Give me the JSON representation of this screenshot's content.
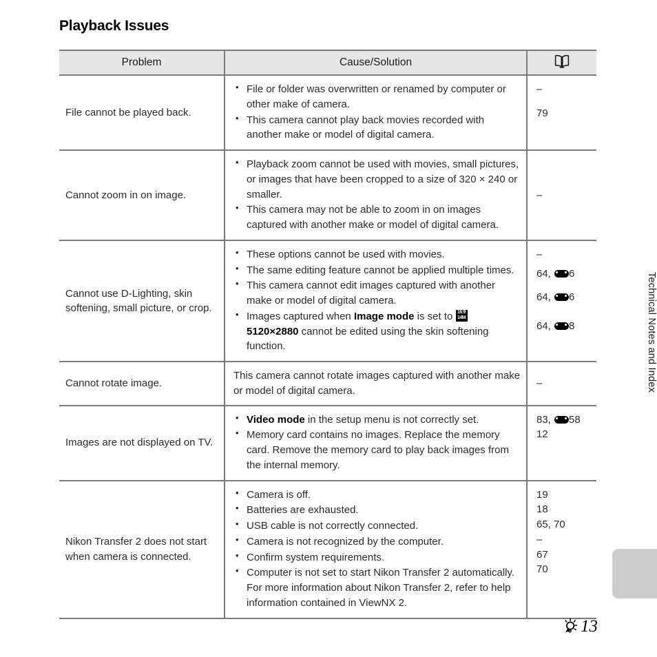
{
  "document": {
    "heading": "Playback Issues",
    "side_chapter_label": "Technical Notes and Index",
    "footer_page": "13",
    "footer_icon": "lightbulb-icon"
  },
  "table": {
    "headers": {
      "problem": "Problem",
      "cause": "Cause/Solution",
      "reference_icon": "open-book-icon"
    },
    "rows": [
      {
        "problem": "File cannot be played back.",
        "causes": [
          "File or folder was overwritten or renamed by computer or other make of camera.",
          "This camera cannot play back movies recorded with another make or model of digital camera."
        ],
        "refs": [
          "–",
          "79"
        ]
      },
      {
        "problem": "Cannot zoom in on image.",
        "causes": [
          "Playback zoom cannot be used with movies, small pictures, or images that have been cropped to a size of 320 × 240 or smaller.",
          "This camera may not be able to zoom in on images captured with another make or model of digital camera."
        ],
        "refs": [
          "–"
        ]
      },
      {
        "problem": "Cannot use D-Lighting, skin softening, small picture, or crop.",
        "causes": [
          "These options cannot be used with movies.",
          "The same editing feature cannot be applied multiple times.",
          "This camera cannot edit images captured with another make or model of digital camera.",
          "Images captured when Image mode is set to 5120×2880 cannot be edited using the skin softening function."
        ],
        "cause_bold_terms": [
          "Image mode",
          "5120×2880"
        ],
        "image_mode_icon": {
          "line1": "16:9",
          "line2": "14M"
        },
        "refs": [
          "–",
          "64, E6",
          "64, E6",
          "64, E8"
        ],
        "refs_parts": [
          {
            "prefix": "–",
            "glyph": false,
            "suffix": ""
          },
          {
            "prefix": "64, ",
            "glyph": true,
            "suffix": "6"
          },
          {
            "prefix": "64, ",
            "glyph": true,
            "suffix": "6"
          },
          {
            "prefix": "64, ",
            "glyph": true,
            "suffix": "8"
          }
        ]
      },
      {
        "problem": "Cannot rotate image.",
        "causes": [
          "This camera cannot rotate images captured with another make or model of digital camera."
        ],
        "bulleted": false,
        "refs": [
          "–"
        ]
      },
      {
        "problem": "Images are not displayed on TV.",
        "causes": [
          "Video mode in the setup menu is not correctly set.",
          "Memory card contains no images. Replace the memory card. Remove the memory card to play back images from the internal memory."
        ],
        "cause_bold_terms": [
          "Video mode"
        ],
        "refs": [
          "83, E58",
          "12"
        ],
        "refs_parts": [
          {
            "prefix": "83, ",
            "glyph": true,
            "suffix": "58"
          },
          {
            "prefix": "12",
            "glyph": false,
            "suffix": ""
          }
        ]
      },
      {
        "problem": "Nikon Transfer 2 does not start when camera is connected.",
        "causes": [
          "Camera is off.",
          "Batteries are exhausted.",
          "USB cable is not correctly connected.",
          "Camera is not recognized by the computer.",
          "Confirm system requirements.",
          "Computer is not set to start Nikon Transfer 2 automatically. For more information about Nikon Transfer 2, refer to help information contained in ViewNX 2."
        ],
        "refs": [
          "19",
          "18",
          "65, 70",
          "–",
          "67",
          "70"
        ]
      }
    ]
  },
  "colors": {
    "border": "#7a7a7a",
    "header_fill": "#e6e6e6",
    "text": "#2b2b2b",
    "side_tab": "#cccccc"
  }
}
